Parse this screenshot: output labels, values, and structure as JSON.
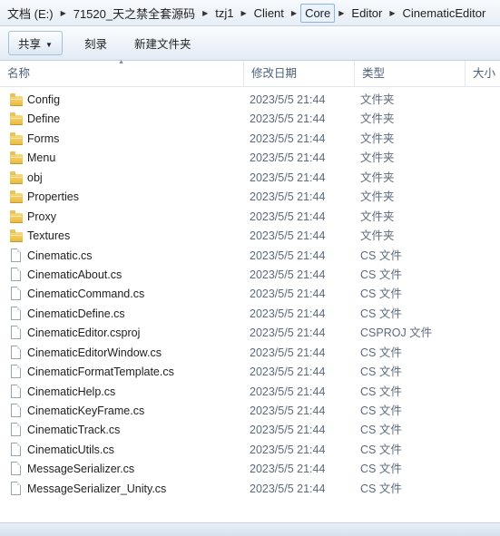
{
  "address_bar": {
    "crumbs": [
      "文档 (E:)",
      "71520_天之禁全套源码",
      "tzj1",
      "Client",
      "Core",
      "Editor",
      "CinematicEditor"
    ]
  },
  "toolbar": {
    "share_label": "共享",
    "burn_label": "刻录",
    "new_folder_label": "新建文件夹"
  },
  "columns": {
    "name": "名称",
    "date": "修改日期",
    "type": "类型",
    "size": "大小"
  },
  "files": [
    {
      "name": "Config",
      "date": "2023/5/5 21:44",
      "type": "文件夹",
      "icon": "folder-icon"
    },
    {
      "name": "Define",
      "date": "2023/5/5 21:44",
      "type": "文件夹",
      "icon": "folder-icon"
    },
    {
      "name": "Forms",
      "date": "2023/5/5 21:44",
      "type": "文件夹",
      "icon": "folder-icon"
    },
    {
      "name": "Menu",
      "date": "2023/5/5 21:44",
      "type": "文件夹",
      "icon": "folder-icon"
    },
    {
      "name": "obj",
      "date": "2023/5/5 21:44",
      "type": "文件夹",
      "icon": "folder-icon"
    },
    {
      "name": "Properties",
      "date": "2023/5/5 21:44",
      "type": "文件夹",
      "icon": "folder-icon"
    },
    {
      "name": "Proxy",
      "date": "2023/5/5 21:44",
      "type": "文件夹",
      "icon": "folder-icon"
    },
    {
      "name": "Textures",
      "date": "2023/5/5 21:44",
      "type": "文件夹",
      "icon": "folder-icon"
    },
    {
      "name": "Cinematic.cs",
      "date": "2023/5/5 21:44",
      "type": "CS 文件",
      "icon": "file-icon"
    },
    {
      "name": "CinematicAbout.cs",
      "date": "2023/5/5 21:44",
      "type": "CS 文件",
      "icon": "file-icon"
    },
    {
      "name": "CinematicCommand.cs",
      "date": "2023/5/5 21:44",
      "type": "CS 文件",
      "icon": "file-icon"
    },
    {
      "name": "CinematicDefine.cs",
      "date": "2023/5/5 21:44",
      "type": "CS 文件",
      "icon": "file-icon"
    },
    {
      "name": "CinematicEditor.csproj",
      "date": "2023/5/5 21:44",
      "type": "CSPROJ 文件",
      "icon": "file-icon"
    },
    {
      "name": "CinematicEditorWindow.cs",
      "date": "2023/5/5 21:44",
      "type": "CS 文件",
      "icon": "file-icon"
    },
    {
      "name": "CinematicFormatTemplate.cs",
      "date": "2023/5/5 21:44",
      "type": "CS 文件",
      "icon": "file-icon"
    },
    {
      "name": "CinematicHelp.cs",
      "date": "2023/5/5 21:44",
      "type": "CS 文件",
      "icon": "file-icon"
    },
    {
      "name": "CinematicKeyFrame.cs",
      "date": "2023/5/5 21:44",
      "type": "CS 文件",
      "icon": "file-icon"
    },
    {
      "name": "CinematicTrack.cs",
      "date": "2023/5/5 21:44",
      "type": "CS 文件",
      "icon": "file-icon"
    },
    {
      "name": "CinematicUtils.cs",
      "date": "2023/5/5 21:44",
      "type": "CS 文件",
      "icon": "file-icon"
    },
    {
      "name": "MessageSerializer.cs",
      "date": "2023/5/5 21:44",
      "type": "CS 文件",
      "icon": "file-icon"
    },
    {
      "name": "MessageSerializer_Unity.cs",
      "date": "2023/5/5 21:44",
      "type": "CS 文件",
      "icon": "file-icon"
    }
  ]
}
